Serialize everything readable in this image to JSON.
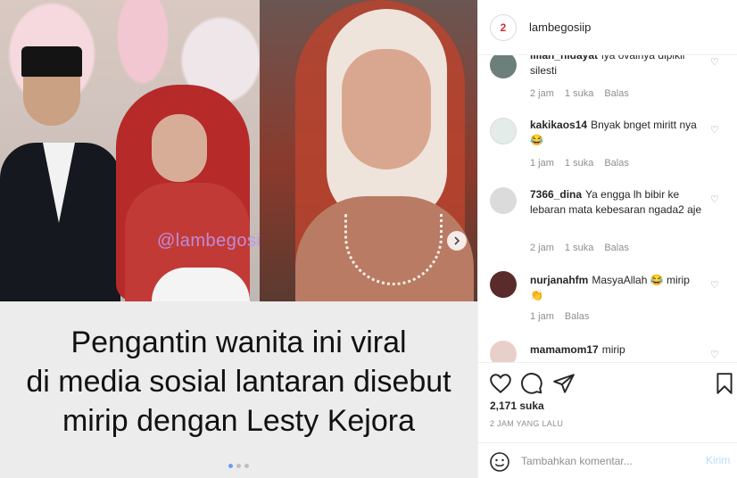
{
  "post": {
    "watermark": "@lambegosiip",
    "caption_lines": [
      "Pengantin wanita ini viral",
      "di media sosial lantaran disebut",
      "mirip dengan Lesty Kejora"
    ],
    "carousel": {
      "count": 3,
      "active_index": 0
    },
    "next_icon": "chevron-right-icon"
  },
  "header": {
    "username": "lambegosiip",
    "avatar_text": "2"
  },
  "comments": [
    {
      "username": "lilian_nidayat",
      "text": "iya ovalnya dipikir silesti",
      "time": "2 jam",
      "likes": "1 suka",
      "reply": "Balas",
      "avatar_color": "#6d7f7a"
    },
    {
      "username": "kakikaos14",
      "text": "Bnyak bnget miritt nya😂",
      "time": "1 jam",
      "likes": "1 suka",
      "reply": "Balas",
      "avatar_color": "#e3ece9"
    },
    {
      "username": "7366_dina",
      "text": "Ya engga lh bibir ke lebaran mata kebesaran ngada2 aje",
      "time": "2 jam",
      "likes": "1 suka",
      "reply": "Balas",
      "avatar_color": "#dbdbdb"
    },
    {
      "username": "nurjanahfm",
      "text": "MasyaAllah 😂 mirip 👏",
      "time": "1 jam",
      "likes": "",
      "reply": "Balas",
      "avatar_color": "#5a2b2b"
    },
    {
      "username": "mamamom17",
      "text": "mirip",
      "time": "",
      "likes": "",
      "reply": "",
      "avatar_color": "#e9cfc9"
    }
  ],
  "actions": {
    "like_icon": "heart-icon",
    "comment_icon": "comment-icon",
    "share_icon": "send-icon",
    "save_icon": "bookmark-icon"
  },
  "likes_text": "2,171 suka",
  "posted_time": "2 JAM YANG LALU",
  "add_comment": {
    "placeholder": "Tambahkan komentar...",
    "post_label": "Kirim",
    "emoji_icon": "emoji-icon"
  },
  "colors": {
    "accent_disabled": "#b2dffc",
    "muted_text": "#8e8e8e",
    "border": "#efefef"
  }
}
